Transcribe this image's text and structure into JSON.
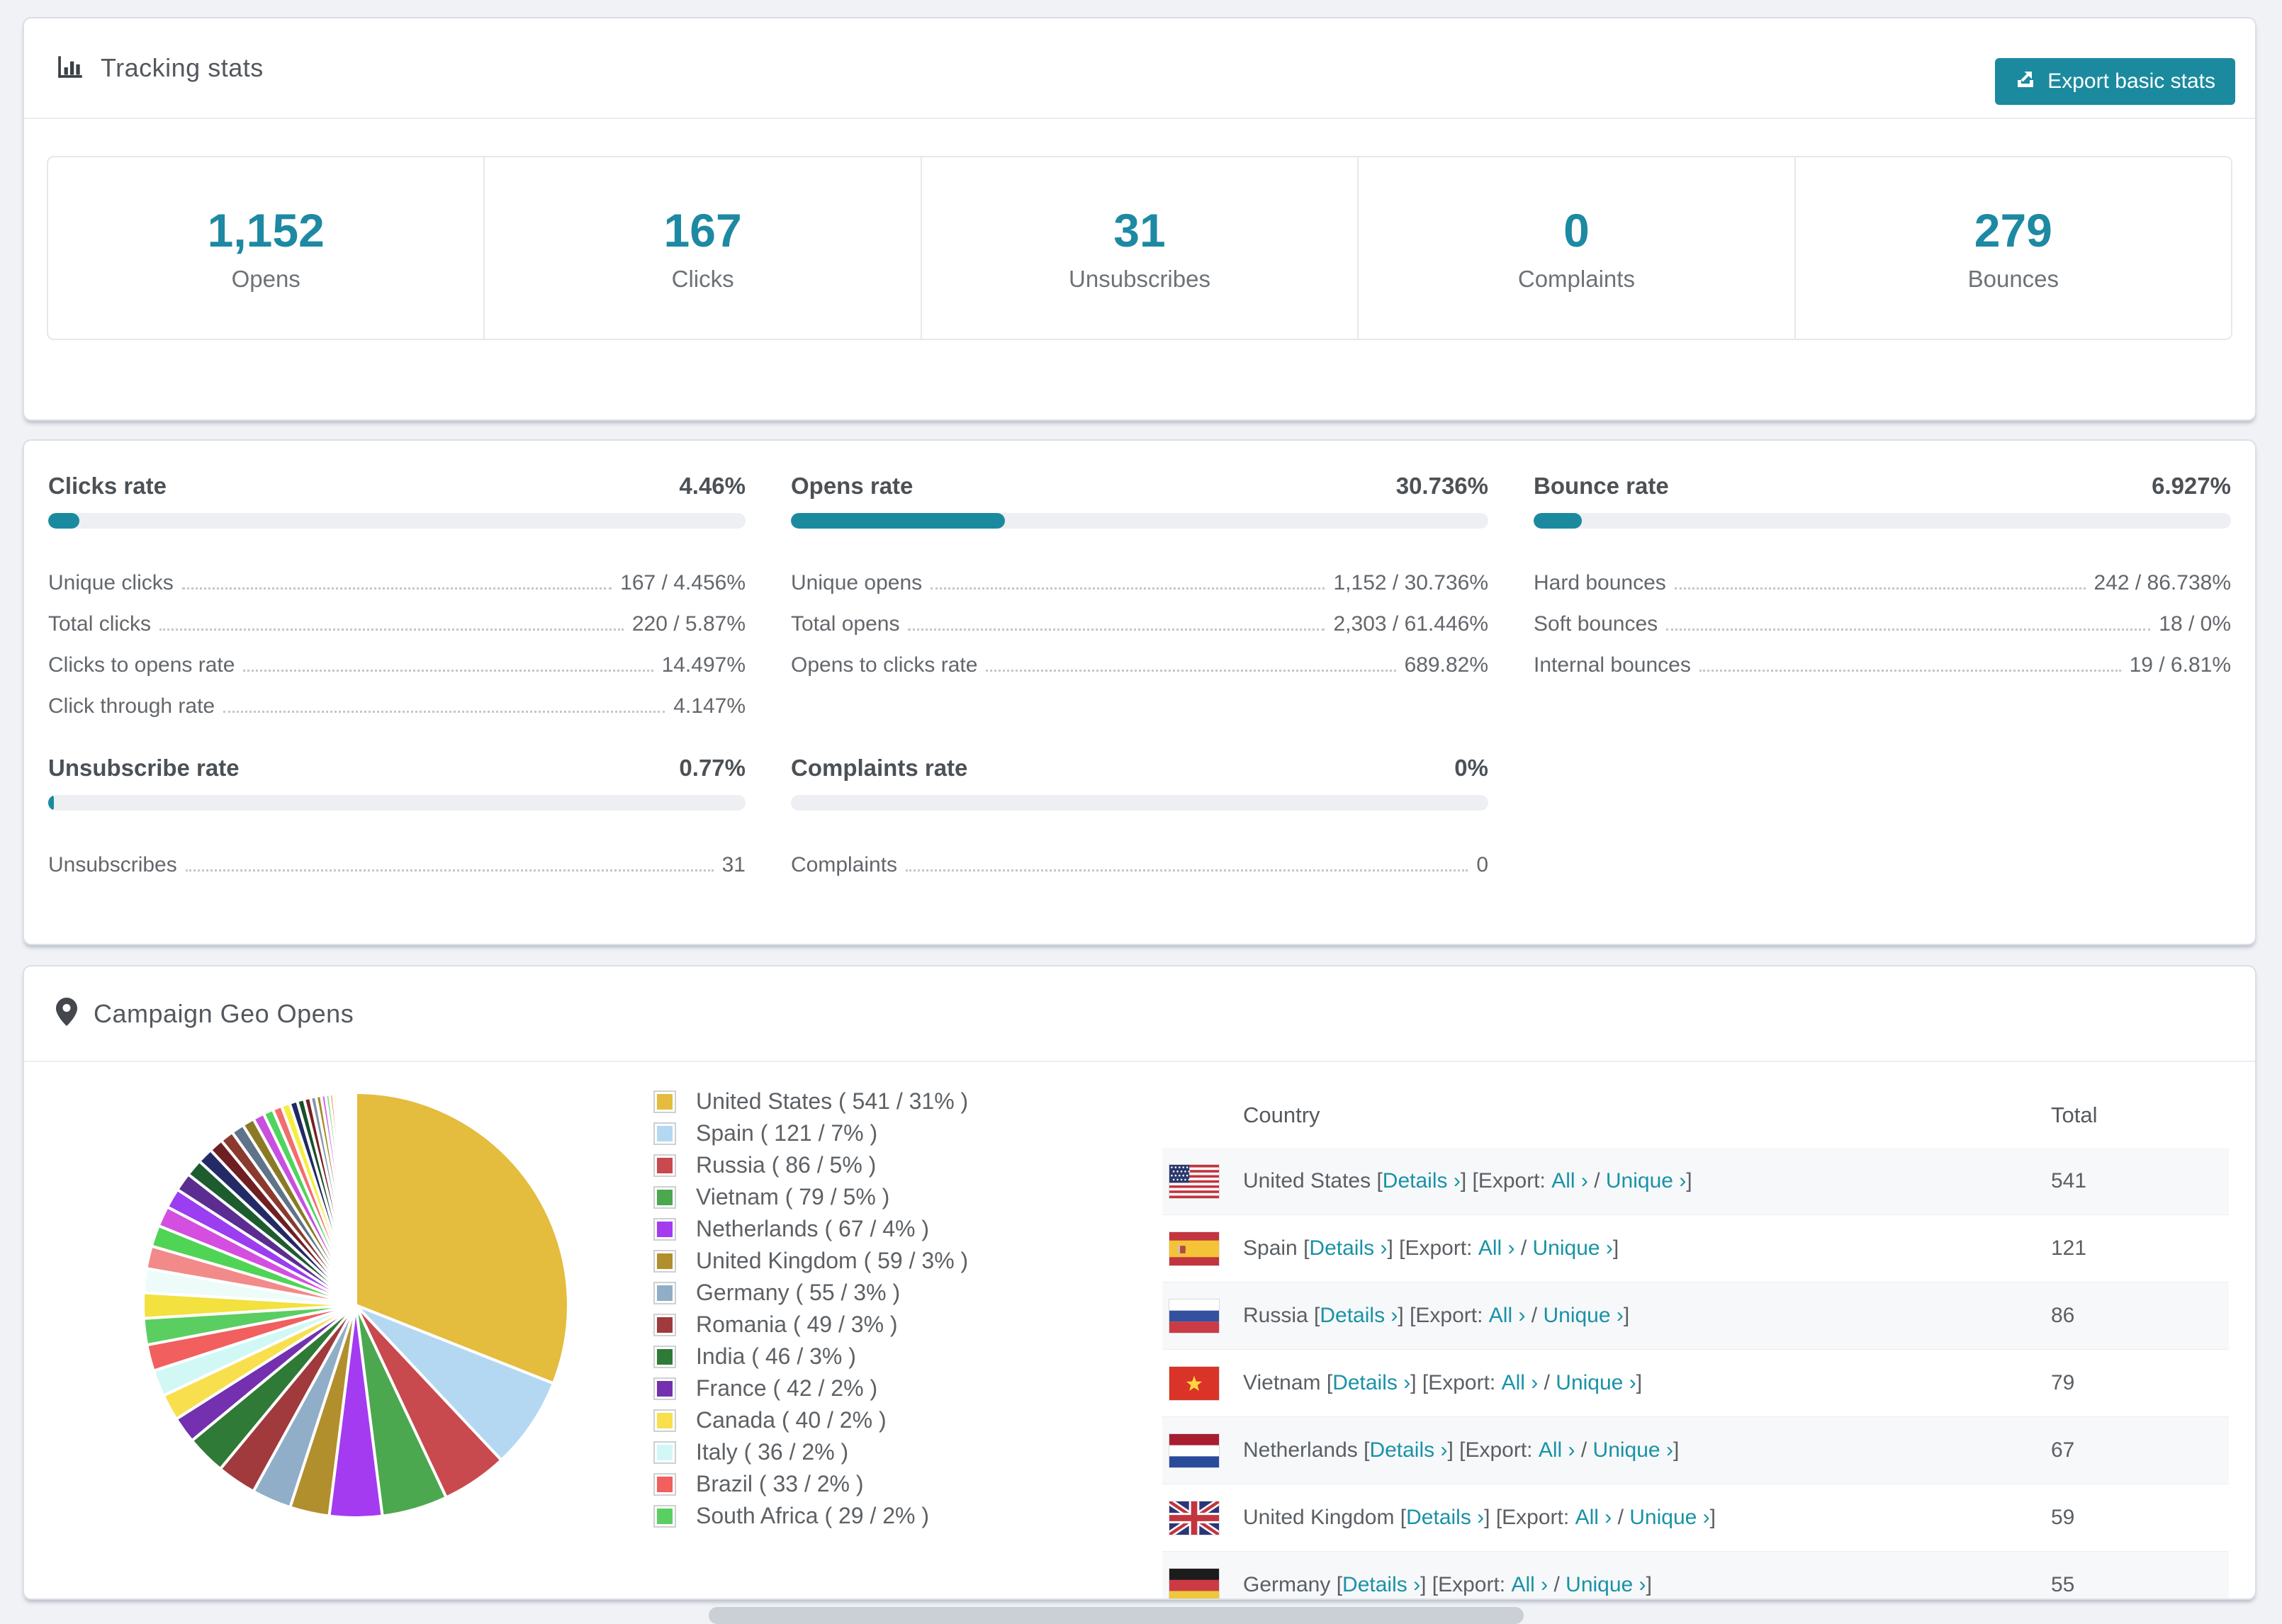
{
  "accent_color": "#1b8a9f",
  "tracking": {
    "title": "Tracking stats",
    "export_button": "Export basic stats",
    "summary": [
      {
        "value": "1,152",
        "label": "Opens"
      },
      {
        "value": "167",
        "label": "Clicks"
      },
      {
        "value": "31",
        "label": "Unsubscribes"
      },
      {
        "value": "0",
        "label": "Complaints"
      },
      {
        "value": "279",
        "label": "Bounces"
      }
    ]
  },
  "rates": {
    "panels": [
      {
        "row": 1,
        "title": "Clicks rate",
        "value": "4.46%",
        "bar_pct": 4.46,
        "rows": [
          {
            "label": "Unique clicks",
            "value": "167 / 4.456%"
          },
          {
            "label": "Total clicks",
            "value": "220 / 5.87%"
          },
          {
            "label": "Clicks to opens rate",
            "value": "14.497%"
          },
          {
            "label": "Click through rate",
            "value": "4.147%"
          }
        ]
      },
      {
        "row": 1,
        "title": "Opens rate",
        "value": "30.736%",
        "bar_pct": 30.736,
        "rows": [
          {
            "label": "Unique opens",
            "value": "1,152 / 30.736%"
          },
          {
            "label": "Total opens",
            "value": "2,303 / 61.446%"
          },
          {
            "label": "Opens to clicks rate",
            "value": "689.82%"
          }
        ]
      },
      {
        "row": 1,
        "title": "Bounce rate",
        "value": "6.927%",
        "bar_pct": 6.927,
        "rows": [
          {
            "label": "Hard bounces",
            "value": "242 / 86.738%"
          },
          {
            "label": "Soft bounces",
            "value": "18 / 0%"
          },
          {
            "label": "Internal bounces",
            "value": "19 / 6.81%"
          }
        ]
      },
      {
        "row": 2,
        "title": "Unsubscribe rate",
        "value": "0.77%",
        "bar_pct": 0.77,
        "rows": [
          {
            "label": "Unsubscribes",
            "value": "31"
          }
        ]
      },
      {
        "row": 2,
        "title": "Complaints rate",
        "value": "0%",
        "bar_pct": 0,
        "rows": [
          {
            "label": "Complaints",
            "value": "0"
          }
        ]
      }
    ]
  },
  "geo": {
    "title": "Campaign Geo Opens",
    "table": {
      "headers": {
        "country": "Country",
        "total": "Total"
      },
      "link_text": {
        "l1": " [",
        "details": "Details ›",
        "l2": "] [Export: ",
        "all": "All ›",
        "l3": " / ",
        "unique": "Unique ›",
        "l4": "]"
      },
      "rows": [
        {
          "flag": "us",
          "country": "United States",
          "total": "541"
        },
        {
          "flag": "es",
          "country": "Spain",
          "total": "121"
        },
        {
          "flag": "ru",
          "country": "Russia",
          "total": "86"
        },
        {
          "flag": "vn",
          "country": "Vietnam",
          "total": "79"
        },
        {
          "flag": "nl",
          "country": "Netherlands",
          "total": "67"
        },
        {
          "flag": "gb",
          "country": "United Kingdom",
          "total": "59"
        },
        {
          "flag": "de",
          "country": "Germany",
          "total": "55"
        }
      ]
    }
  },
  "chart_data": {
    "type": "pie",
    "title": "Campaign Geo Opens",
    "legend_position": "right",
    "slices": [
      {
        "name": "United States",
        "count": 541,
        "pct": 31,
        "color": "#e4bc3e",
        "label": "United States ( 541 / 31% )"
      },
      {
        "name": "Spain",
        "count": 121,
        "pct": 7,
        "color": "#b5d8f2",
        "label": "Spain ( 121 / 7% )"
      },
      {
        "name": "Russia",
        "count": 86,
        "pct": 5,
        "color": "#c8494e",
        "label": "Russia ( 86 / 5% )"
      },
      {
        "name": "Vietnam",
        "count": 79,
        "pct": 5,
        "color": "#4ba84f",
        "label": "Vietnam ( 79 / 5% )"
      },
      {
        "name": "Netherlands",
        "count": 67,
        "pct": 4,
        "color": "#a43bf0",
        "label": "Netherlands ( 67 / 4% )"
      },
      {
        "name": "United Kingdom",
        "count": 59,
        "pct": 3,
        "color": "#b28f2d",
        "label": "United Kingdom ( 59 / 3% )"
      },
      {
        "name": "Germany",
        "count": 55,
        "pct": 3,
        "color": "#90aec7",
        "label": "Germany ( 55 / 3% )"
      },
      {
        "name": "Romania",
        "count": 49,
        "pct": 3,
        "color": "#a03a3c",
        "label": "Romania ( 49 / 3% )"
      },
      {
        "name": "India",
        "count": 46,
        "pct": 3,
        "color": "#2f7a36",
        "label": "India ( 46 / 3% )"
      },
      {
        "name": "France",
        "count": 42,
        "pct": 2,
        "color": "#7430ae",
        "label": "France ( 42 / 2% )"
      },
      {
        "name": "Canada",
        "count": 40,
        "pct": 2,
        "color": "#f8df4e",
        "label": "Canada ( 40 / 2% )"
      },
      {
        "name": "Italy",
        "count": 36,
        "pct": 2,
        "color": "#d2f8f6",
        "label": "Italy ( 36 / 2% )"
      },
      {
        "name": "Brazil",
        "count": 33,
        "pct": 2,
        "color": "#f15f5f",
        "label": "Brazil ( 33 / 2% )"
      },
      {
        "name": "South Africa",
        "count": 29,
        "pct": 2,
        "color": "#5bce62",
        "label": "South Africa ( 29 / 2% )"
      }
    ],
    "others": {
      "values": [
        1.8,
        1.7,
        1.6,
        1.5,
        1.45,
        1.4,
        1.3,
        1.2,
        1.1,
        1.0,
        0.95,
        0.9,
        0.85,
        0.8,
        0.7,
        0.65,
        0.6,
        0.55,
        0.5,
        0.45,
        0.4,
        0.36,
        0.32,
        0.28,
        0.25,
        0.22,
        0.2,
        0.18,
        0.16,
        0.14,
        0.12,
        0.11,
        0.1,
        0.09,
        0.08,
        0.07,
        0.06,
        0.05
      ],
      "colors": [
        "#f2e13e",
        "#eefcf9",
        "#f28a8a",
        "#4fd455",
        "#d44fe0",
        "#9b3df0",
        "#5b2d91",
        "#1d5c2e",
        "#232a66",
        "#6e1f22",
        "#8a3a2e",
        "#5f7389",
        "#8a7a26",
        "#c94fe0",
        "#4fd45f",
        "#f26d6d",
        "#f5ee3e",
        "#1f2a63",
        "#17502a",
        "#7a1f24",
        "#8396a8",
        "#a08a1e",
        "#d96df0",
        "#66e06e",
        "#ff5a4e",
        "#f7ee49",
        "#9fc9f0",
        "#cf53f0",
        "#6ef26e",
        "#e03e3e",
        "#c9a22e",
        "#8a5bf0",
        "#f09fbf",
        "#4f8ad4",
        "#66cf8a",
        "#d4cf4f",
        "#bdbdbd"
      ]
    }
  }
}
